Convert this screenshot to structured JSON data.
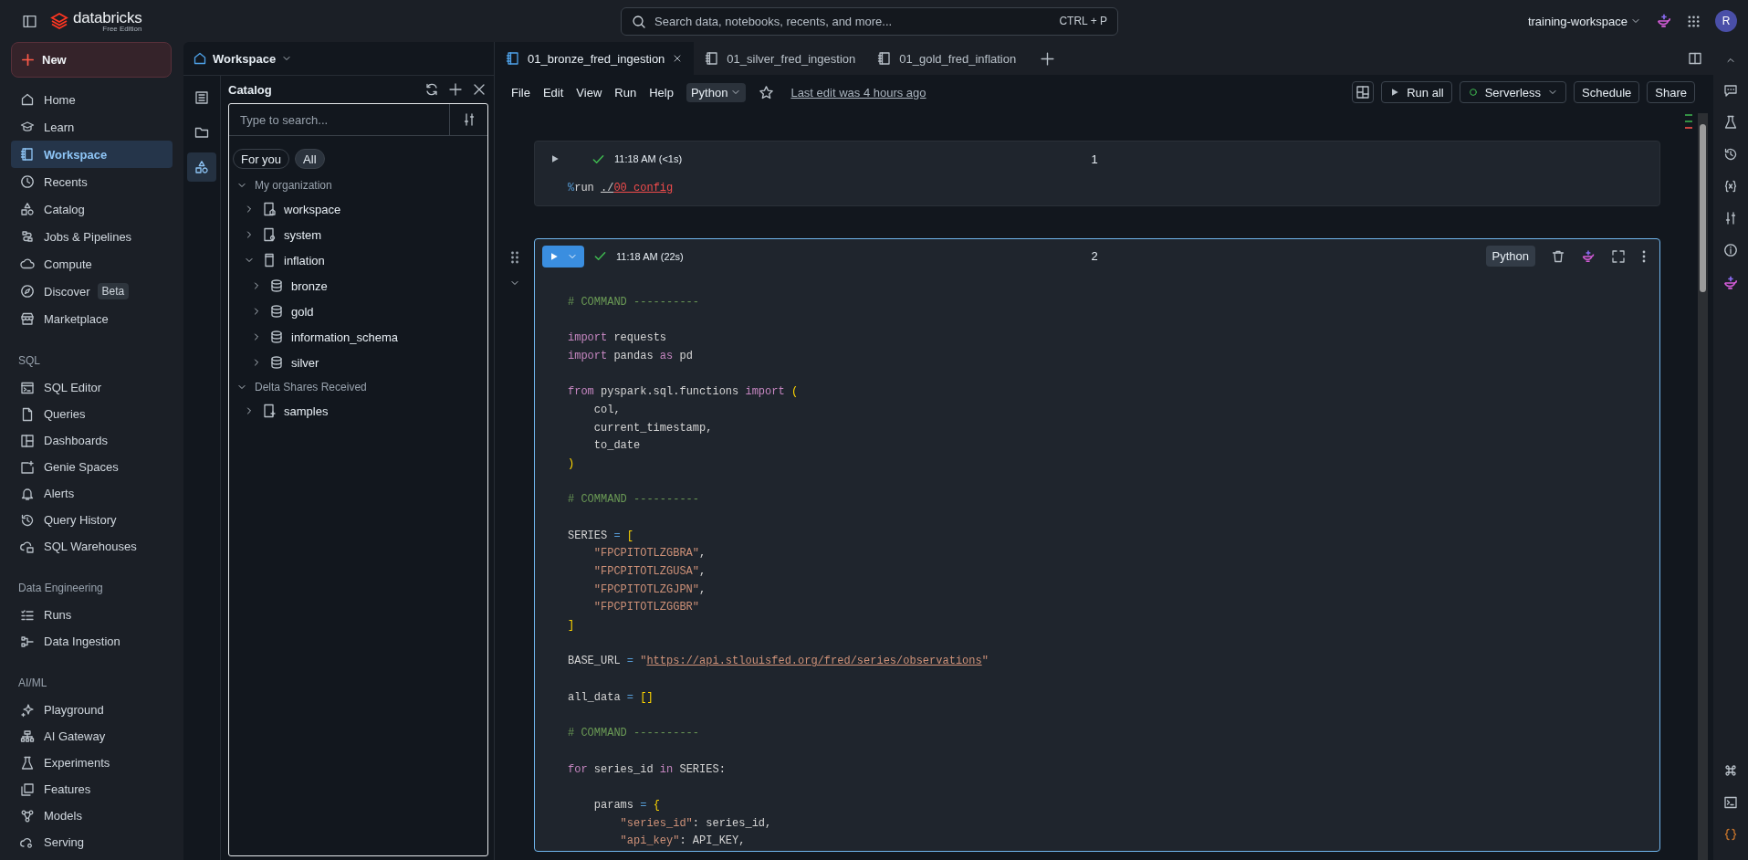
{
  "top_bar": {
    "brand": "databricks",
    "edition": "Free Edition",
    "search": {
      "placeholder": "Search data, notebooks, recents, and more...",
      "shortcut": "CTRL + P"
    },
    "workspace": "training-workspace",
    "avatar": "R"
  },
  "sidebar": {
    "new_button": "New",
    "sections": [
      {
        "items": [
          {
            "label": "Home",
            "selected": false
          },
          {
            "label": "Learn",
            "selected": false
          },
          {
            "label": "Workspace",
            "selected": true
          },
          {
            "label": "Recents",
            "selected": false
          },
          {
            "label": "Catalog",
            "selected": false
          },
          {
            "label": "Jobs & Pipelines",
            "selected": false
          },
          {
            "label": "Compute",
            "selected": false
          },
          {
            "label": "Discover",
            "badge": "Beta",
            "selected": false
          },
          {
            "label": "Marketplace",
            "selected": false
          }
        ]
      },
      {
        "heading": "SQL",
        "items": [
          {
            "label": "SQL Editor",
            "selected": false
          },
          {
            "label": "Queries",
            "selected": false
          },
          {
            "label": "Dashboards",
            "selected": false
          },
          {
            "label": "Genie Spaces",
            "selected": false
          },
          {
            "label": "Alerts",
            "selected": false
          },
          {
            "label": "Query History",
            "selected": false
          },
          {
            "label": "SQL Warehouses",
            "selected": false
          }
        ]
      },
      {
        "heading": "Data Engineering",
        "items": [
          {
            "label": "Runs",
            "selected": false
          },
          {
            "label": "Data Ingestion",
            "selected": false
          }
        ]
      },
      {
        "heading": "AI/ML",
        "items": [
          {
            "label": "Playground",
            "selected": false
          },
          {
            "label": "AI Gateway",
            "selected": false
          },
          {
            "label": "Experiments",
            "selected": false
          },
          {
            "label": "Features",
            "selected": false
          },
          {
            "label": "Models",
            "selected": false
          },
          {
            "label": "Serving",
            "selected": false
          }
        ]
      }
    ]
  },
  "workspace_panel": {
    "title": "Workspace",
    "strip": [
      {
        "selected": false
      },
      {
        "selected": false
      },
      {
        "selected": true
      }
    ],
    "catalog": {
      "title": "Catalog",
      "search": {
        "placeholder": "Type to search..."
      },
      "filters": [
        {
          "label": "For you",
          "selected": false
        },
        {
          "label": "All",
          "selected": true
        }
      ],
      "tree": [
        {
          "label": "My organization",
          "kind": "group",
          "expanded": true,
          "children": [
            {
              "label": "workspace",
              "kind": "catalog",
              "expanded": false
            },
            {
              "label": "system",
              "kind": "system",
              "expanded": false
            },
            {
              "label": "inflation",
              "kind": "catalog_plain",
              "expanded": true,
              "children": [
                {
                  "label": "bronze",
                  "kind": "schema",
                  "expanded": false
                },
                {
                  "label": "gold",
                  "kind": "schema",
                  "expanded": false
                },
                {
                  "label": "information_schema",
                  "kind": "schema",
                  "expanded": false
                },
                {
                  "label": "silver",
                  "kind": "schema",
                  "expanded": false
                }
              ]
            }
          ]
        },
        {
          "label": "Delta Shares Received",
          "kind": "group",
          "expanded": true,
          "children": [
            {
              "label": "samples",
              "kind": "share",
              "expanded": false
            }
          ]
        }
      ]
    }
  },
  "notebook": {
    "tabs": [
      {
        "label": "01_bronze_fred_ingestion",
        "selected": true
      },
      {
        "label": "01_silver_fred_ingestion",
        "selected": false
      },
      {
        "label": "01_gold_fred_inflation",
        "selected": false
      }
    ],
    "menu": [
      "File",
      "Edit",
      "View",
      "Run",
      "Help"
    ],
    "language": "Python",
    "starred": false,
    "last_edit": "Last edit was 4 hours ago",
    "actions": {
      "run_all": "Run all",
      "compute": "Serverless",
      "compute_connected": true,
      "schedule": "Schedule",
      "share": "Share"
    },
    "cells": [
      {
        "number": "1",
        "time": "11:18 AM (<1s)",
        "succeeded": true,
        "selected": false,
        "lines": [
          {
            "kind": "code",
            "tokens": [
              {
                "kind": "magic",
                "text": "%"
              },
              {
                "kind": "text",
                "text": "run "
              },
              {
                "kind": "path",
                "text": "./"
              },
              {
                "kind": "error",
                "text": "00_config"
              }
            ]
          }
        ]
      },
      {
        "number": "2",
        "time": "11:18 AM (22s)",
        "succeeded": true,
        "selected": true,
        "language": "Python",
        "lines": [
          {
            "kind": "code",
            "tokens": [
              {
                "kind": "comment",
                "text": "# COMMAND ----------"
              }
            ]
          },
          {
            "kind": "blank"
          },
          {
            "kind": "code",
            "tokens": [
              {
                "kind": "keyword",
                "text": "import"
              },
              {
                "kind": "text",
                "text": " requests"
              }
            ]
          },
          {
            "kind": "code",
            "tokens": [
              {
                "kind": "keyword",
                "text": "import"
              },
              {
                "kind": "text",
                "text": " pandas "
              },
              {
                "kind": "keyword",
                "text": "as"
              },
              {
                "kind": "text",
                "text": " pd"
              }
            ]
          },
          {
            "kind": "blank"
          },
          {
            "kind": "code",
            "tokens": [
              {
                "kind": "keyword",
                "text": "from"
              },
              {
                "kind": "text",
                "text": " pyspark.sql.functions "
              },
              {
                "kind": "keyword",
                "text": "import "
              },
              {
                "kind": "bracket",
                "text": "("
              }
            ]
          },
          {
            "kind": "code",
            "tokens": [
              {
                "kind": "text",
                "text": "    col,"
              }
            ]
          },
          {
            "kind": "code",
            "tokens": [
              {
                "kind": "text",
                "text": "    current_timestamp,"
              }
            ]
          },
          {
            "kind": "code",
            "tokens": [
              {
                "kind": "text",
                "text": "    to_date"
              }
            ]
          },
          {
            "kind": "code",
            "tokens": [
              {
                "kind": "bracket",
                "text": ")"
              }
            ]
          },
          {
            "kind": "blank"
          },
          {
            "kind": "code",
            "tokens": [
              {
                "kind": "comment",
                "text": "# COMMAND ----------"
              }
            ]
          },
          {
            "kind": "blank"
          },
          {
            "kind": "code",
            "tokens": [
              {
                "kind": "text",
                "text": "SERIES "
              },
              {
                "kind": "operator",
                "text": "= "
              },
              {
                "kind": "bracket",
                "text": "["
              }
            ]
          },
          {
            "kind": "code",
            "tokens": [
              {
                "kind": "string",
                "text": "    \"FPCPITOTLZGBRA\""
              },
              {
                "kind": "text",
                "text": ","
              }
            ]
          },
          {
            "kind": "code",
            "tokens": [
              {
                "kind": "string",
                "text": "    \"FPCPITOTLZGUSA\""
              },
              {
                "kind": "text",
                "text": ","
              }
            ]
          },
          {
            "kind": "code",
            "tokens": [
              {
                "kind": "string",
                "text": "    \"FPCPITOTLZGJPN\""
              },
              {
                "kind": "text",
                "text": ","
              }
            ]
          },
          {
            "kind": "code",
            "tokens": [
              {
                "kind": "string",
                "text": "    \"FPCPITOTLZGGBR\""
              }
            ]
          },
          {
            "kind": "code",
            "tokens": [
              {
                "kind": "bracket",
                "text": "]"
              }
            ]
          },
          {
            "kind": "blank"
          },
          {
            "kind": "code",
            "tokens": [
              {
                "kind": "text",
                "text": "BASE_URL "
              },
              {
                "kind": "operator",
                "text": "= "
              },
              {
                "kind": "string",
                "text": "\""
              },
              {
                "kind": "url",
                "text": "https://api.stlouisfed.org/fred/series/observations"
              },
              {
                "kind": "string",
                "text": "\""
              }
            ]
          },
          {
            "kind": "blank"
          },
          {
            "kind": "code",
            "tokens": [
              {
                "kind": "text",
                "text": "all_data "
              },
              {
                "kind": "operator",
                "text": "= "
              },
              {
                "kind": "bracket",
                "text": "[]"
              }
            ]
          },
          {
            "kind": "blank"
          },
          {
            "kind": "code",
            "tokens": [
              {
                "kind": "comment",
                "text": "# COMMAND ----------"
              }
            ]
          },
          {
            "kind": "blank"
          },
          {
            "kind": "code",
            "tokens": [
              {
                "kind": "keyword",
                "text": "for"
              },
              {
                "kind": "text",
                "text": " series_id "
              },
              {
                "kind": "keyword",
                "text": "in"
              },
              {
                "kind": "text",
                "text": " SERIES:"
              }
            ]
          },
          {
            "kind": "blank"
          },
          {
            "kind": "code",
            "tokens": [
              {
                "kind": "text",
                "text": "    params "
              },
              {
                "kind": "operator",
                "text": "= "
              },
              {
                "kind": "bracket",
                "text": "{"
              }
            ]
          },
          {
            "kind": "code",
            "tokens": [
              {
                "kind": "string",
                "text": "        \"series_id\""
              },
              {
                "kind": "text",
                "text": ": series_id,"
              }
            ]
          },
          {
            "kind": "code",
            "tokens": [
              {
                "kind": "string",
                "text": "        \"api_key\""
              },
              {
                "kind": "text",
                "text": ": API_KEY,"
              }
            ]
          }
        ]
      }
    ]
  }
}
